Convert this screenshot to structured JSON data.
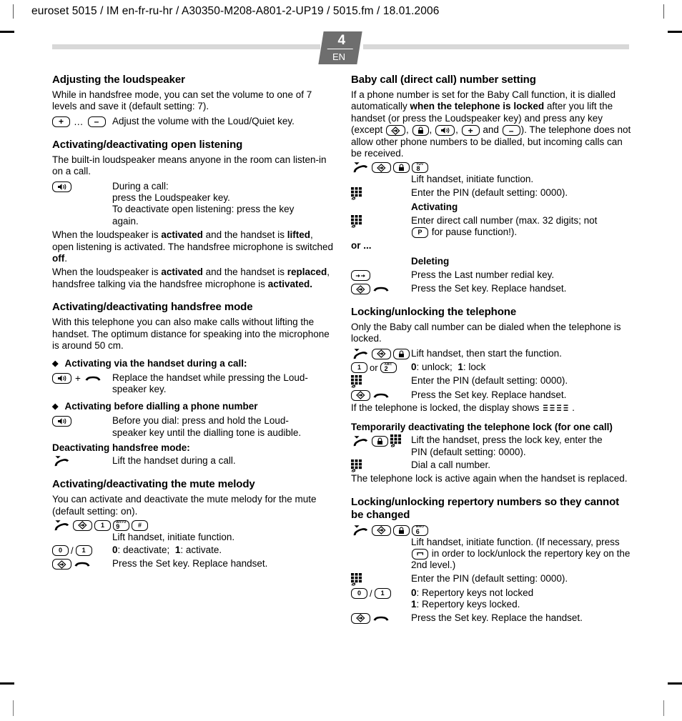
{
  "header": {
    "running_head": "euroset 5015 / IM en-fr-ru-hr / A30350-M208-A801-2-UP19 / 5015.fm / 18.01.2006"
  },
  "page_tab": {
    "number": "4",
    "language": "EN"
  },
  "left_column": {
    "s1": {
      "heading": "Adjusting the loudspeaker",
      "p1": "While in handsfree mode, you can set the volume to one of 7 levels and save it (default setting: 7).",
      "step1_text": "Adjust the volume with the Loud/Quiet key."
    },
    "s2": {
      "heading": "Activating/deactivating open listening",
      "p1": "The built-in loudspeaker means anyone in the room can listen-in on a call.",
      "step1_l1": "During a call:",
      "step1_l2": "press the Loudspeaker key.",
      "step1_l3": "To deactivate open listening: press the key",
      "step1_l4": "again.",
      "p2_a": "When the loudspeaker is ",
      "p2_b": "activated",
      "p2_c": " and the handset is ",
      "p2_d": "lifted",
      "p2_e": ", open listening is activated. The handsfree microphone is switched ",
      "p2_f": "off",
      "p2_g": ".",
      "p3_a": "When the loudspeaker is ",
      "p3_b": "activated",
      "p3_c": " and the handset is ",
      "p3_d": "replaced",
      "p3_e": ", handsfree talking via the handsfree microphone is ",
      "p3_f": "activated."
    },
    "s3": {
      "heading": "Activating/deactivating handsfree mode",
      "p1": "With this telephone you can also make calls without lifting the handset. The optimum distance for speaking into the microphone is around 50 cm.",
      "bullet1": "Activating via the handset during a call:",
      "step1_l1": "Replace the handset while pressing the Loud-",
      "step1_l2": "speaker key.",
      "bullet2": "Activating before dialling a phone number",
      "step2_l1": "Before you dial: press and hold the Loud-",
      "step2_l2": "speaker key until the dialling tone is audible.",
      "sub_heading": "Deactivating handsfree mode:",
      "step3_text": "Lift the handset during a call."
    },
    "s4": {
      "heading": "Activating/deactivating the mute melody",
      "p1": "You can activate and deactivate the mute melody for the mute (default setting: on).",
      "step1_text": "Lift handset, initiate function.",
      "step2_a": "0",
      "step2_b": ": deactivate;",
      "step2_c": "1",
      "step2_d": ": activate.",
      "step3_text": "Press the Set key. Replace handset."
    }
  },
  "right_column": {
    "s1": {
      "heading": "Baby call (direct call) number setting",
      "p1_a": "If a phone number is set for the Baby Call function, it is dialled automatically ",
      "p1_b": "when the telephone is locked",
      "p1_c": " after you lift the handset (or press the Loudspeaker key) and press any key (except ",
      "p1_d": ", ",
      "p1_e": ", ",
      "p1_f": " and ",
      "p1_g": "). The telephone does not allow other phone numbers to be dialled, but incoming calls can be received.",
      "step1_text": "Lift handset, initiate function.",
      "step2_text": "Enter the PIN (default setting: 0000).",
      "sub1": "Activating",
      "step3_l1": "Enter direct call number (max. 32 digits; not",
      "step3_l2_a": "for pause function!).",
      "or": "or ...",
      "sub2": "Deleting",
      "step4_text": "Press the Last number redial key.",
      "step5_text": "Press the Set key. Replace handset."
    },
    "s2": {
      "heading": "Locking/unlocking the telephone",
      "p1": "Only the Baby call number can be dialed when the telephone is locked.",
      "step1_text": "Lift handset, then start the function.",
      "step2_or": "or",
      "step2_a": "0",
      "step2_b": ": unlock;",
      "step2_c": "1",
      "step2_d": ": lock",
      "step3_text": "Enter the PIN (default setting: 0000).",
      "step4_text": "Press the Set key. Replace handset.",
      "p2_a": "If the telephone is locked, the display shows ",
      "p2_b": "."
    },
    "s3": {
      "heading": "Temporarily deactivating the telephone lock (for one call)",
      "step1_l1": "Lift the handset, press the lock key, enter the",
      "step1_l2": "PIN (default setting: 0000).",
      "step2_text": "Dial a call number.",
      "p1": "The telephone lock is active again when the handset is replaced."
    },
    "s4": {
      "heading_l1": "Locking/unlocking repertory numbers so they cannot",
      "heading_l2": "be changed",
      "step1_l1": "Lift handset, initiate function.",
      "step1_l2_a": "(If necessary, press ",
      "step1_l2_b": " in order to lock/unlock",
      "step1_l3": "the repertory key on the 2nd level.)",
      "step2_text": "Enter the PIN (default setting: 0000).",
      "step3_sep": "/",
      "step3_a": "0",
      "step3_b": ": Repertory keys not locked",
      "step3_c": "1",
      "step3_d": ": Repertory keys locked.",
      "step4_text": "Press the Set key. Replace the handset."
    }
  },
  "keys": {
    "plus": "+",
    "minus": "–",
    "hash": "#",
    "digit_0": "0",
    "digit_1": "1",
    "digit_2": "2",
    "digit_2_letters": "ABC",
    "digit_6": "6",
    "digit_6_letters": "MNO",
    "digit_8": "8",
    "digit_8_letters": "TUV",
    "digit_9": "9",
    "digit_9_letters": "WXYZ",
    "pause": "P",
    "ellipsis": "…",
    "plus_sign": "+"
  }
}
